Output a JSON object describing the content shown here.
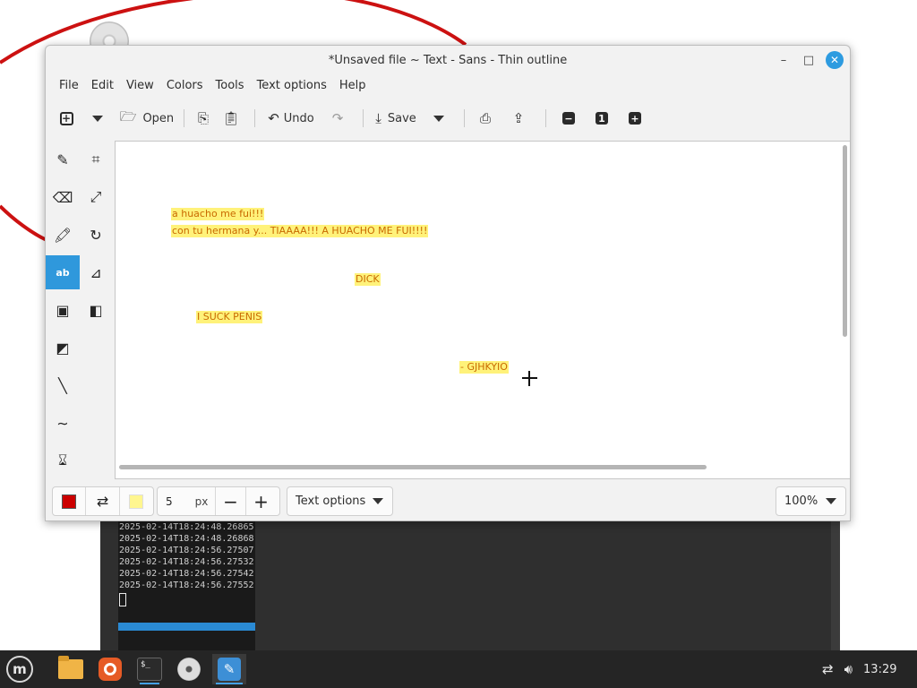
{
  "window": {
    "title": "*Unsaved file ~ Text - Sans - Thin outline",
    "controls": {
      "minimize": "–",
      "maximize": "□",
      "close": "✕"
    }
  },
  "menubar": [
    "File",
    "Edit",
    "View",
    "Colors",
    "Tools",
    "Text options",
    "Help"
  ],
  "toolbar": {
    "open_label": "Open",
    "undo_label": "Undo",
    "save_label": "Save",
    "zoom_out_glyph": "−",
    "zoom_reset_glyph": "1",
    "zoom_in_glyph": "+"
  },
  "tools": {
    "text_tool_label": "ab"
  },
  "canvas": {
    "texts": [
      "a huacho me fui!!!",
      "con tu hermana y... TIAAAA!!! A HUACHO ME FUI!!!!",
      "DICK",
      "I SUCK PENIS",
      "- GJHKYIO"
    ],
    "text_color": "#c96a00",
    "highlight_color": "#fff27a"
  },
  "bottombar": {
    "main_color": "#cc0000",
    "secondary_color": "#fff68f",
    "size_value": "5",
    "size_unit": "px",
    "minus": "−",
    "plus": "+",
    "options_label": "Text options",
    "zoom_label": "100%"
  },
  "terminal": {
    "lines": [
      "2025-02-14T18:24:48.26865",
      "2025-02-14T18:24:48.26868",
      "2025-02-14T18:24:56.27507",
      "2025-02-14T18:24:56.27532",
      "2025-02-14T18:24:56.27542",
      "2025-02-14T18:24:56.27552"
    ]
  },
  "taskbar": {
    "terminal_icon_text": "$_",
    "clock": "13:29",
    "accent": "#45a1e6"
  }
}
